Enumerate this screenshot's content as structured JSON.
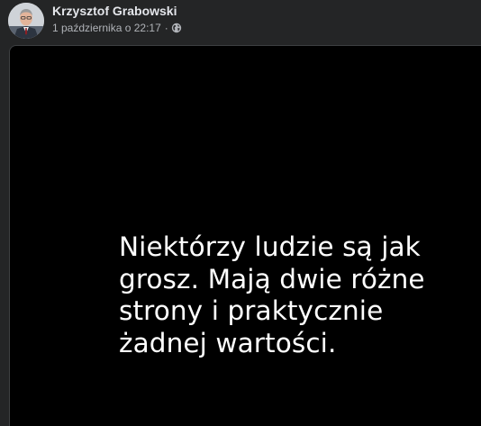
{
  "post": {
    "author_name": "Krzysztof Grabowski",
    "timestamp": "1 października o 22:17",
    "separator": "·",
    "privacy_icon": "globe-icon",
    "avatar_icon": "profile-photo"
  },
  "image": {
    "background_color": "#000000",
    "text_color": "#ffffff",
    "quote_lines": [
      "Niektórzy ludzie są jak",
      "grosz. Mają dwie różne",
      "strony i praktycznie",
      "żadnej wartości."
    ]
  },
  "colors": {
    "page_background": "#242526",
    "author_text": "#e4e6eb",
    "meta_text": "#b0b3b8"
  }
}
